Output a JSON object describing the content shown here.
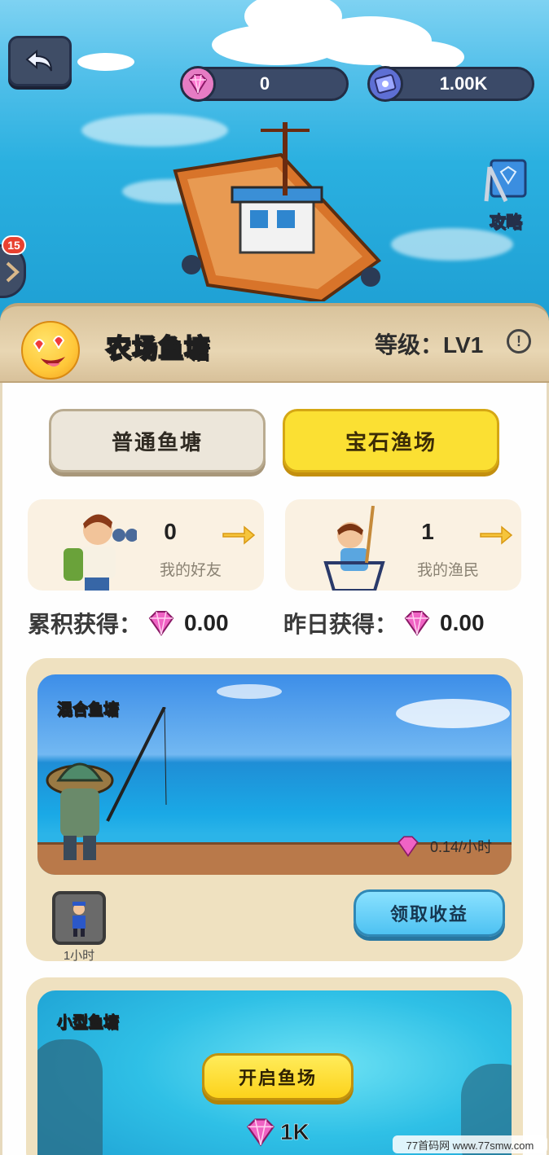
{
  "topbar": {
    "gems": "0",
    "tickets": "1.00K",
    "guide_label": "攻略",
    "side_badge": "15"
  },
  "header": {
    "title": "农场鱼塘",
    "level": "等级：LV1",
    "info": "!"
  },
  "tabs": [
    {
      "label": "普通鱼塘",
      "active": false
    },
    {
      "label": "宝石渔场",
      "active": true
    }
  ],
  "stats": {
    "friends": {
      "value": "0",
      "label": "我的好友"
    },
    "fishers": {
      "value": "1",
      "label": "我的渔民"
    }
  },
  "earnings": {
    "total_label": "累积获得：",
    "total_value": "0.00",
    "yesterday_label": "昨日获得：",
    "yesterday_value": "0.00"
  },
  "ponds": [
    {
      "name": "混合鱼塘",
      "rate": "0.14/小时",
      "worker_label": "1小时",
      "action": "领取收益"
    },
    {
      "name": "小型鱼塘",
      "action": "开启鱼场",
      "cost": "1K"
    }
  ],
  "watermark": "77首码网 www.77smw.com",
  "colors": {
    "gem_pink": "#e73fae",
    "tab_active": "#fbe033",
    "collect_blue": "#4ec2f2"
  }
}
